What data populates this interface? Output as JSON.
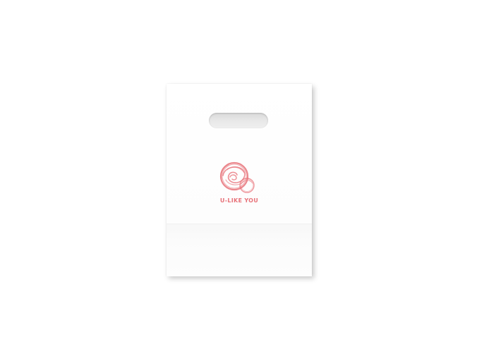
{
  "product": {
    "brand_text": "U-LIKE YOU",
    "logo_icon": "swirl-circle-logo-icon",
    "logo_color": "#e8737a",
    "bag_color": "#ffffff",
    "handle_type": "die-cut-handle-icon"
  }
}
